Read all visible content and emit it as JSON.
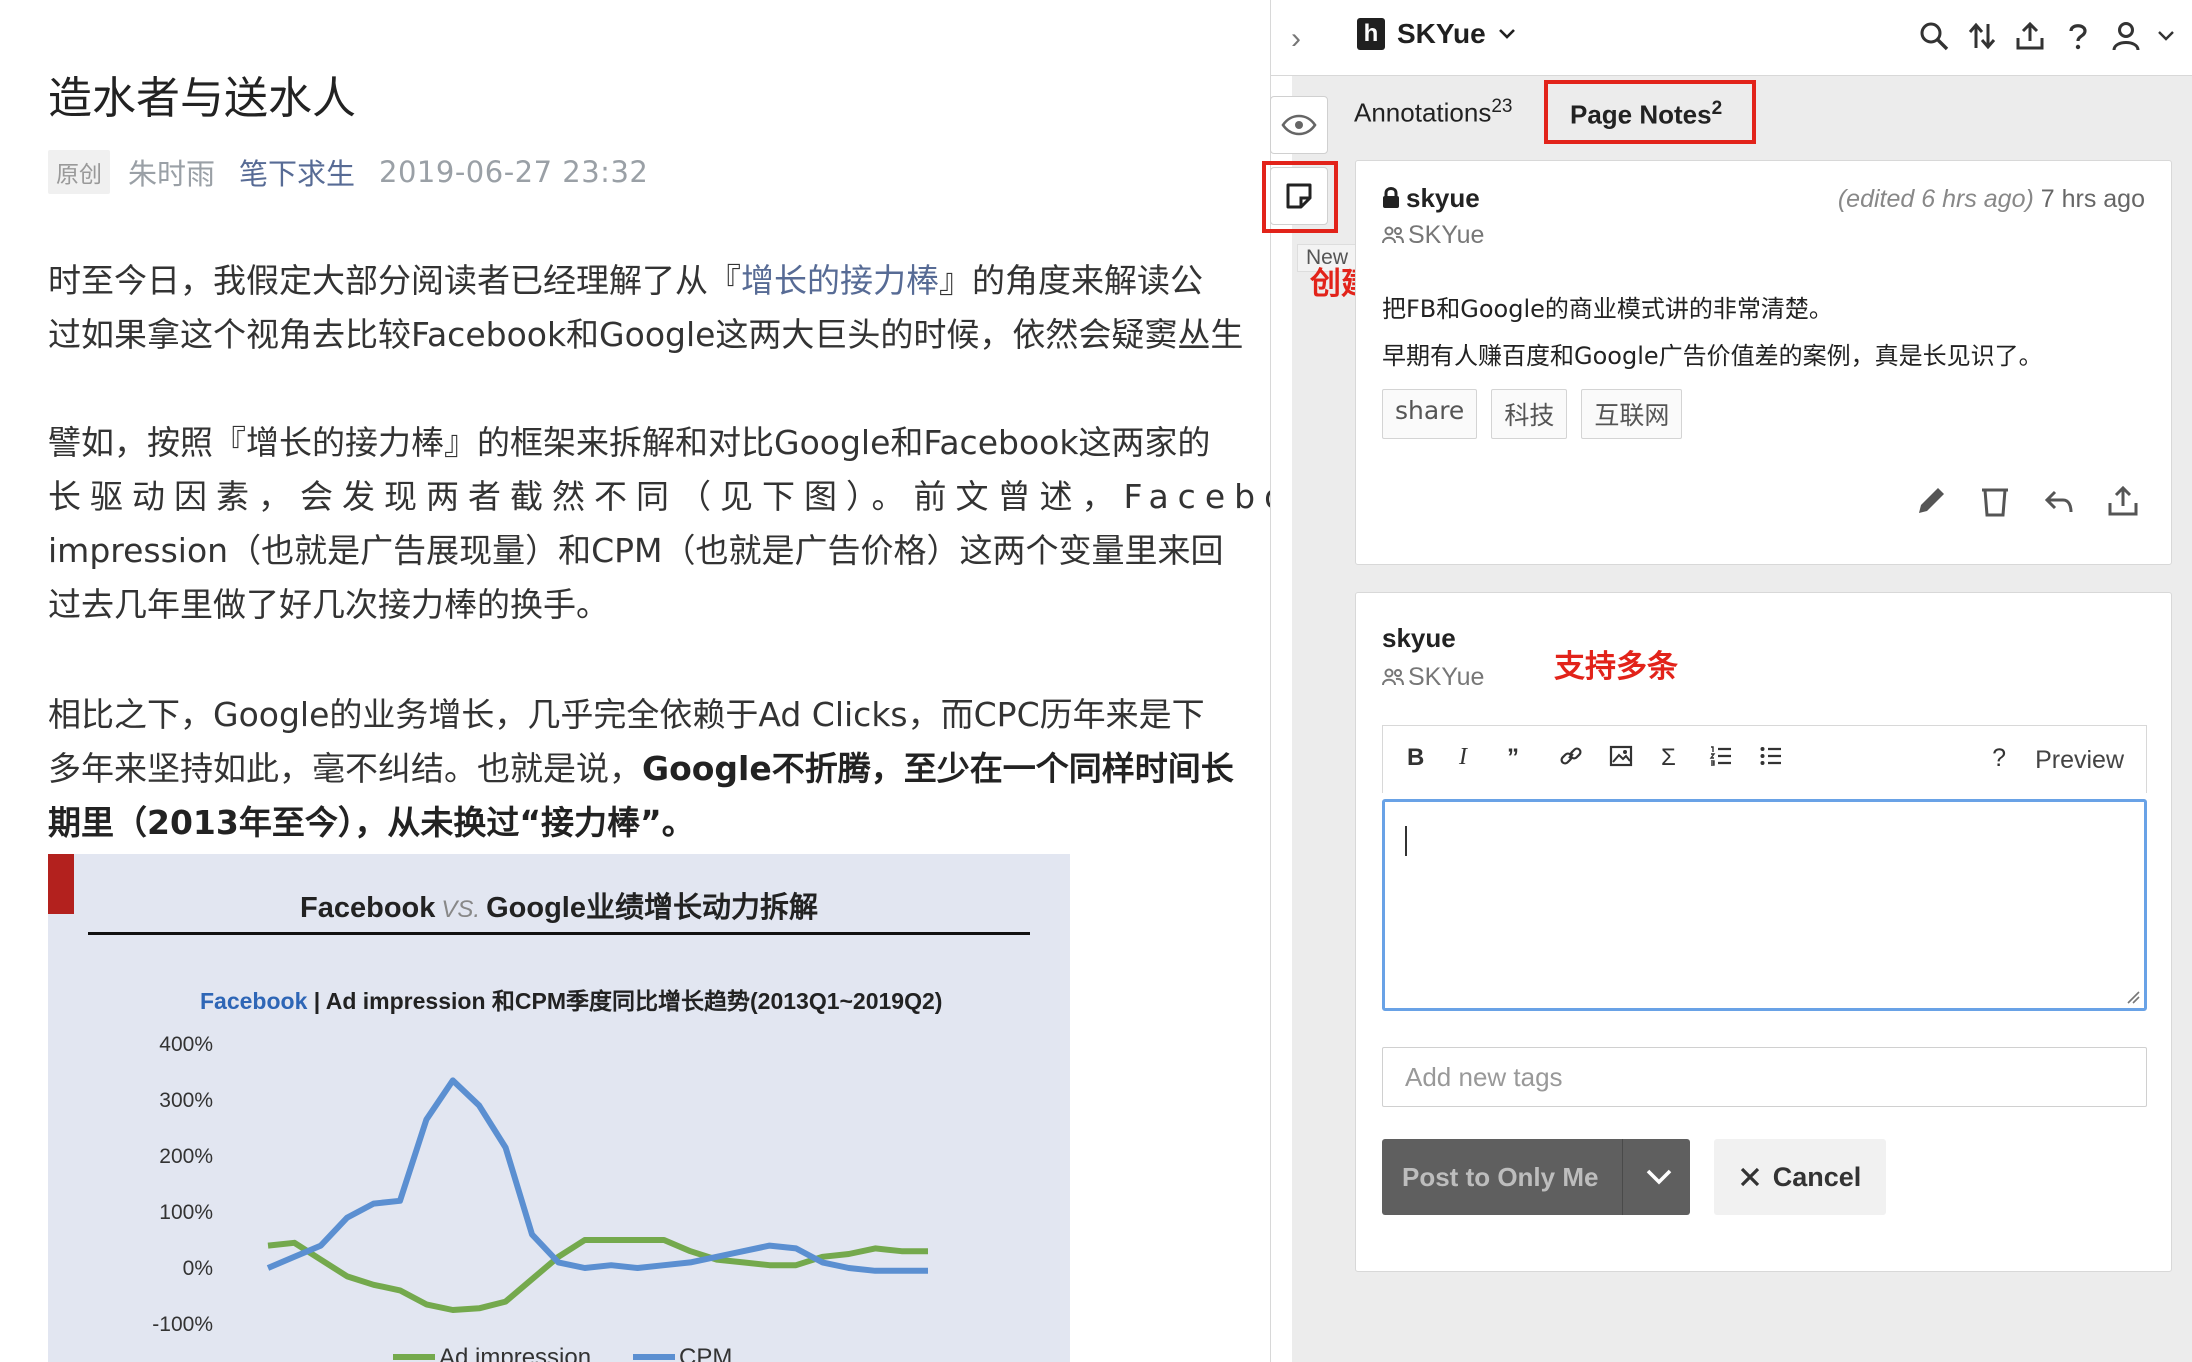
{
  "article": {
    "title": "造水者与送水人",
    "badge": "原创",
    "author": "朱时雨",
    "source": "笔下求生",
    "date": "2019-06-27 23:32",
    "p1": {
      "l1_a": "时至今日，我假定大部分阅读者已经理解了从『",
      "l1_link": "增长的接力棒",
      "l1_b": "』的角度来解读公",
      "l2": "过如果拿这个视角去比较Facebook和Google这两大巨头的时候，依然会疑窦丛生"
    },
    "p2": {
      "l1": "譬如，按照『增长的接力棒』的框架来拆解和对比Google和Facebook这两家的",
      "l2": "长驱动因素，会发现两者截然不同（见下图）。前文曾述，Facebook是",
      "l3": "impression（也就是广告展现量）和CPM（也就是广告价格）这两个变量里来回",
      "l4": "过去几年里做了好几次接力棒的换手。"
    },
    "p3": {
      "l1": "相比之下，Google的业务增长，几乎完全依赖于Ad Clicks，而CPC历年来是下",
      "l2_a": "多年来坚持如此，毫不纠结。也就是说，",
      "l2_b": "Google不折腾，至少在一个同样时间长",
      "l3": "期里（2013年至今），从未换过“接力棒”。"
    }
  },
  "figure": {
    "title_left": "Facebook",
    "title_vs": "VS.",
    "title_right": "Google业绩增长动力拆解",
    "subtitle_brand": "Facebook",
    "subtitle_rest": " | Ad impression 和CPM季度同比增长趋势(2013Q1~2019Q2)"
  },
  "chart_data": {
    "type": "line",
    "title": "Facebook | Ad impression 和CPM季度同比增长趋势(2013Q1~2019Q2)",
    "xlabel": "",
    "ylabel": "",
    "ylim": [
      -100,
      400
    ],
    "yticks": [
      "400%",
      "300%",
      "200%",
      "100%",
      "0%",
      "-100%"
    ],
    "legend_position": "bottom",
    "series": [
      {
        "name": "Ad impression",
        "color": "#74a94d",
        "values": [
          40,
          45,
          15,
          -15,
          -30,
          -40,
          -65,
          -75,
          -72,
          -60,
          -20,
          20,
          50,
          50,
          50,
          50,
          30,
          15,
          10,
          5,
          5,
          20,
          25,
          35,
          30,
          30
        ]
      },
      {
        "name": "CPM",
        "color": "#5b8fd1",
        "values": [
          0,
          20,
          40,
          90,
          115,
          120,
          265,
          335,
          290,
          215,
          60,
          10,
          0,
          5,
          0,
          5,
          10,
          20,
          30,
          40,
          35,
          10,
          0,
          -5,
          -5,
          -5
        ]
      }
    ]
  },
  "sidebar": {
    "group": "SKYue",
    "tabs": {
      "annotations_label": "Annotations",
      "annotations_count": "23",
      "notes_label": "Page Notes",
      "notes_count": "2"
    },
    "tooltip": "New page note",
    "callout_create": "创建page note",
    "callout_multi": "支持多条",
    "note": {
      "user": "skyue",
      "group": "SKYue",
      "edited": "(edited 6 hrs ago)",
      "time": " 7 hrs ago",
      "line1": "把FB和Google的商业模式讲的非常清楚。",
      "line2": "早期有人赚百度和Google广告价值差的案例，真是长见识了。",
      "tags": [
        "share",
        "科技",
        "互联网"
      ]
    },
    "editor": {
      "user": "skyue",
      "group": "SKYue",
      "preview": "Preview",
      "help": "?",
      "tags_placeholder": "Add new tags",
      "post_label": "Post to Only Me",
      "cancel_label": "Cancel"
    }
  }
}
